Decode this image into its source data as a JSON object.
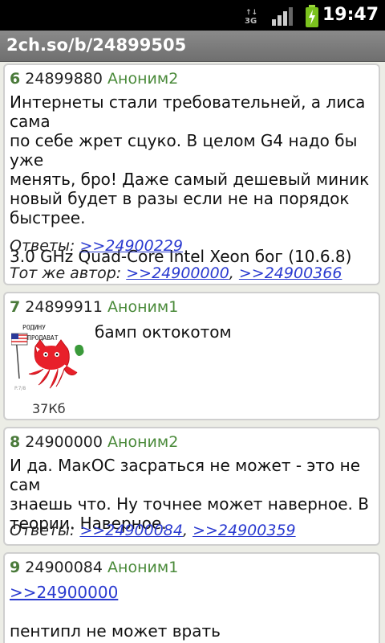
{
  "statusbar": {
    "time": "19:47",
    "network_label": "3G"
  },
  "titlebar": {
    "title": "2ch.so/b/24899505"
  },
  "posts": [
    {
      "num": "6",
      "id": "24899880",
      "author": "Аноним2",
      "lines": [
        "Интернеты стали требовательней, а лиса сама",
        "по себе жрет сцуко. В целом G4 надо бы уже",
        "менять, бро! Даже самый дешевый миник",
        "новый будет в разы если не на порядок",
        "быстрее.",
        "",
        "3.0 GHz Quad-Core Intel Xeon бог (10.6.8)"
      ],
      "replies_label": "Ответы:",
      "replies": [
        ">>24900229"
      ],
      "same_author_label": "Тот же автор:",
      "same_author": [
        ">>24900000",
        ">>24900366"
      ]
    },
    {
      "num": "7",
      "id": "24899911",
      "author": "Аноним1",
      "text": "бамп октокотом",
      "image_caption_top": "РОДИНУ",
      "image_caption_bottom": "ПРОДАВАТ",
      "image_size": "37Кб"
    },
    {
      "num": "8",
      "id": "24900000",
      "author": "Аноним2",
      "lines": [
        "И да. МакОС засраться не может - это не сам",
        "знаешь что. Ну точнее может наверное. В",
        "теории. Наверное."
      ],
      "replies_label": "Ответы:",
      "replies": [
        ">>24900084",
        ">>24900359"
      ]
    },
    {
      "num": "9",
      "id": "24900084",
      "author": "Аноним1",
      "quote_link": ">>24900000",
      "lines": [
        "",
        "пентипл не может врать"
      ]
    }
  ]
}
